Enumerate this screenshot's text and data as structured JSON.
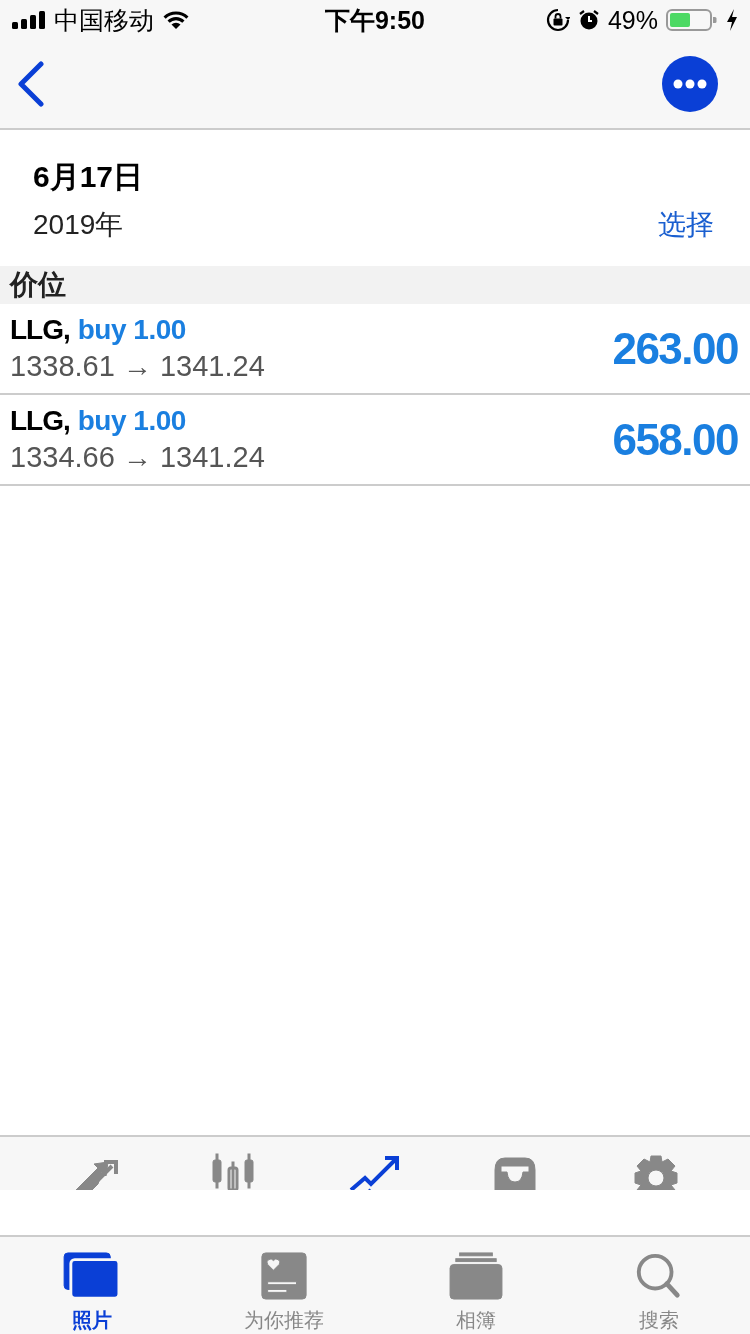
{
  "status_bar": {
    "carrier": "中国移动",
    "time": "下午9:50",
    "battery_percent": "49%"
  },
  "header": {
    "date": "6月17日",
    "year": "2019年",
    "select": "选择"
  },
  "section": {
    "title": "价位"
  },
  "rows": [
    {
      "symbol": "LLG,",
      "order": "buy 1.00",
      "prices": "1338.61 → 1341.24",
      "profit": "263.00"
    },
    {
      "symbol": "LLG,",
      "order": "buy 1.00",
      "prices": "1334.66 → 1341.24",
      "profit": "658.00"
    }
  ],
  "toolbar": [
    {
      "kind": "trade",
      "selected": false
    },
    {
      "kind": "quotes",
      "selected": false
    },
    {
      "kind": "chart",
      "selected": true
    },
    {
      "kind": "inbox",
      "selected": false
    },
    {
      "kind": "settings",
      "selected": false
    }
  ],
  "tabs": [
    {
      "kind": "photos",
      "label": "照片",
      "selected": true
    },
    {
      "kind": "for-you",
      "label": "为你推荐",
      "selected": false
    },
    {
      "kind": "albums",
      "label": "相簿",
      "selected": false
    },
    {
      "kind": "search",
      "label": "搜索",
      "selected": false
    }
  ]
}
